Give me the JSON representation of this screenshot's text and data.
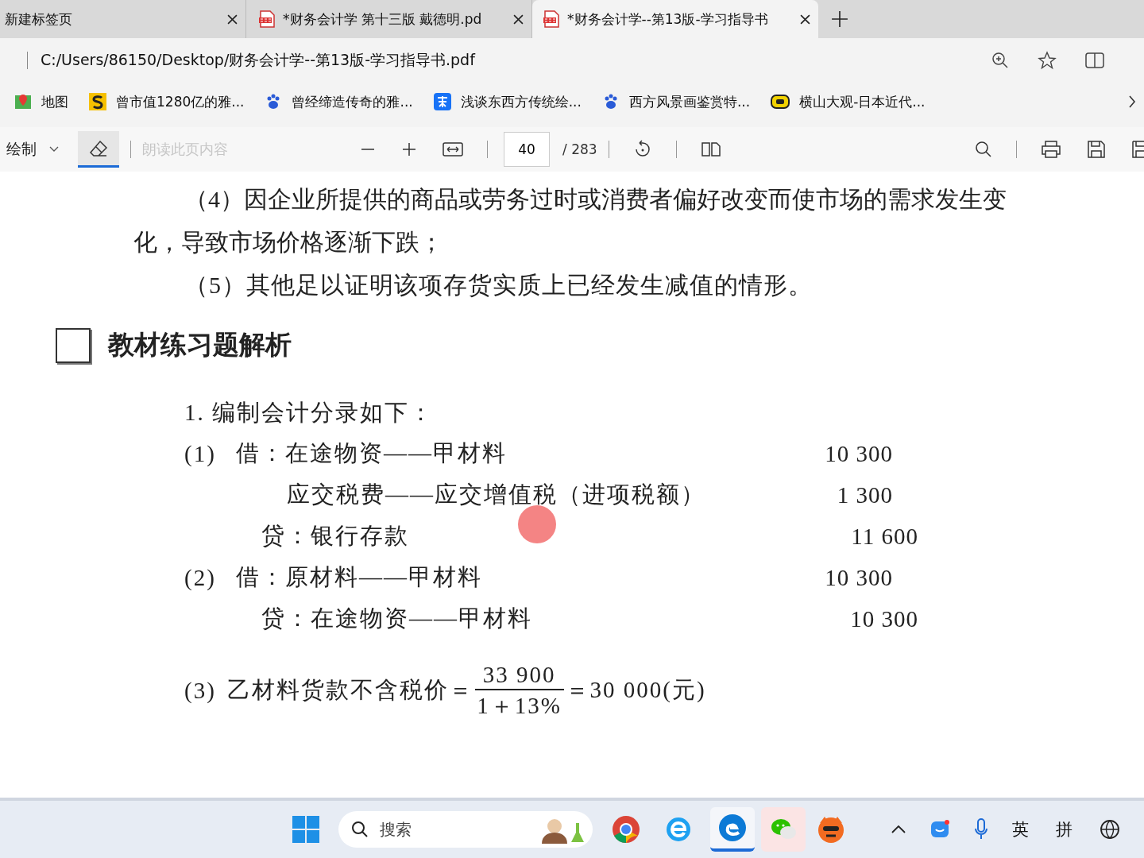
{
  "tabs": [
    {
      "title": "新建标签页",
      "kind": "plain",
      "selected": false
    },
    {
      "title": "*财务会计学 第十三版 戴德明.pd",
      "kind": "pdf",
      "selected": false
    },
    {
      "title": "*财务会计学--第13版-学习指导书",
      "kind": "pdf",
      "selected": true
    }
  ],
  "address": {
    "url": "C:/Users/86150/Desktop/财务会计学--第13版-学习指导书.pdf"
  },
  "bookmarks": [
    {
      "label": "地图",
      "kind": "map"
    },
    {
      "label": "曾市值1280亿的雅...",
      "kind": "s"
    },
    {
      "label": "曾经缔造传奇的雅...",
      "kind": "paw"
    },
    {
      "label": "浅谈东西方传统绘...",
      "kind": "zhi"
    },
    {
      "label": "西方风景画鉴赏特...",
      "kind": "paw"
    },
    {
      "label": "横山大观-日本近代...",
      "kind": "video"
    }
  ],
  "pdf_toolbar": {
    "draw_label": "绘制",
    "eraser_selected": true,
    "read_aloud": {
      "label": "朗读此页内容",
      "disabled": true
    },
    "page": "40",
    "total": "/ 283"
  },
  "document": {
    "paragraphs": [
      "（4）因企业所提供的商品或劳务过时或消费者偏好改变而使市场的需求发生变化，导致市场价格逐渐下跌；",
      "（5）其他足以证明该项存货实质上已经发生减值的情形。"
    ],
    "section_heading": "教材练习题解析",
    "intro": "1. 编制会计分录如下：",
    "entries": [
      {
        "kind": "debit",
        "number": "(1)",
        "text": "借：在途物资——甲材料",
        "amount": "10 300"
      },
      {
        "kind": "debit_more",
        "text": "应交税费——应交增值税（进项税额）",
        "amount": "1 300"
      },
      {
        "kind": "credit",
        "text": "贷：银行存款",
        "amount": "11 600"
      },
      {
        "kind": "debit",
        "number": "(2)",
        "text": "借：原材料——甲材料",
        "amount": "10 300"
      },
      {
        "kind": "credit",
        "text": "贷：在途物资——甲材料",
        "amount": "10 300"
      }
    ],
    "formula": {
      "number": "(3)",
      "lead": "乙材料货款不含税价＝",
      "numerator": "33 900",
      "denominator": "1＋13%",
      "result": "＝30 000(元)"
    }
  },
  "taskbar": {
    "search_placeholder": "搜索",
    "ime": [
      "英",
      "拼"
    ]
  }
}
